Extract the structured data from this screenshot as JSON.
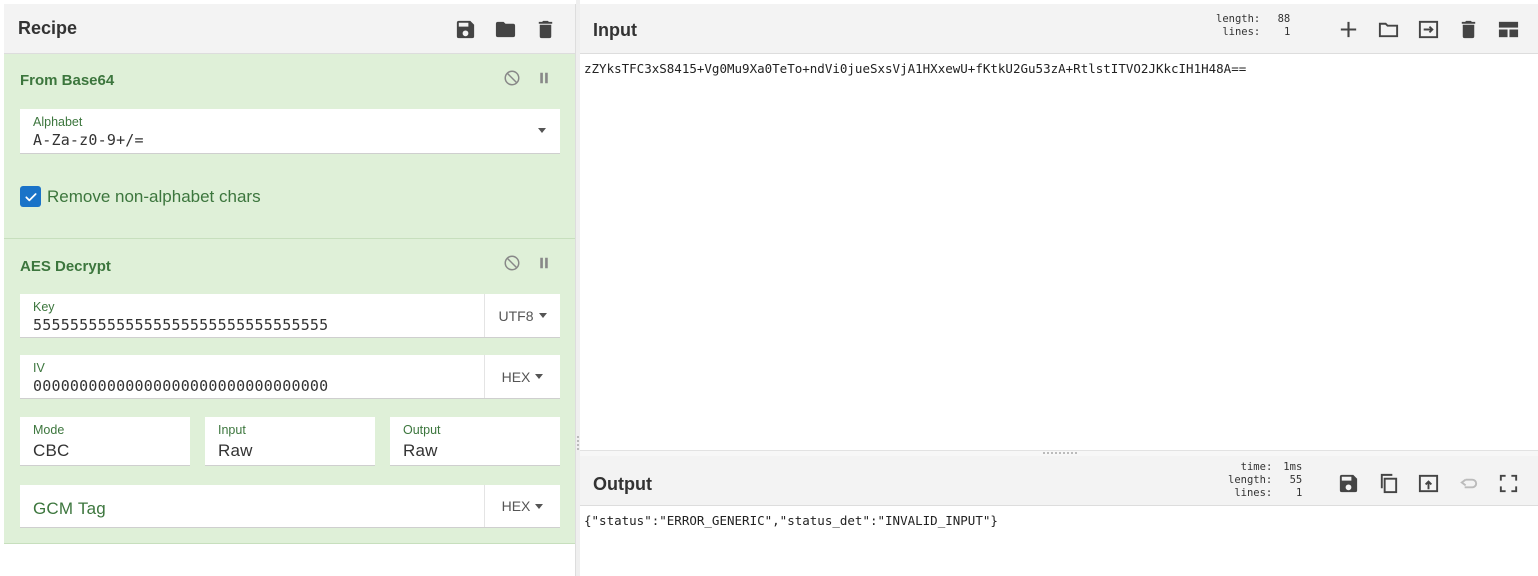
{
  "recipe": {
    "title": "Recipe",
    "header_icons": [
      "save-icon",
      "folder-icon",
      "trash-icon"
    ]
  },
  "operations": {
    "from_base64": {
      "title": "From Base64",
      "alphabet_label": "Alphabet",
      "alphabet_value": "A-Za-z0-9+/=",
      "remove_non_alpha_label": "Remove non-alphabet chars",
      "remove_non_alpha_checked": true
    },
    "aes_decrypt": {
      "title": "AES Decrypt",
      "key_label": "Key",
      "key_value": "55555555555555555555555555555555",
      "key_encoding": "UTF8",
      "iv_label": "IV",
      "iv_value": "00000000000000000000000000000000",
      "iv_encoding": "HEX",
      "mode_label": "Mode",
      "mode_value": "CBC",
      "input_label": "Input",
      "input_value": "Raw",
      "output_label": "Output",
      "output_value": "Raw",
      "gcm_tag_placeholder": "GCM Tag",
      "gcm_tag_encoding": "HEX"
    }
  },
  "input": {
    "title": "Input",
    "length_label": "length:",
    "length_value": "88",
    "lines_label": "lines:",
    "lines_value": "1",
    "text": "zZYksTFC3xS8415+Vg0Mu9Xa0TeTo+ndVi0jueSxsVjA1HXxewU+fKtkU2Gu53zA+RtlstITVO2JKkcIH1H48A=="
  },
  "output": {
    "title": "Output",
    "time_label": "time:",
    "time_value": "1ms",
    "length_label": "length:",
    "length_value": "55",
    "lines_label": "lines:",
    "lines_value": "1",
    "text": "{\"status\":\"ERROR_GENERIC\",\"status_det\":\"INVALID_INPUT\"}"
  },
  "colors": {
    "op_background": "#dff0d8",
    "op_text": "#3c763d",
    "checkbox": "#1a73c8"
  }
}
